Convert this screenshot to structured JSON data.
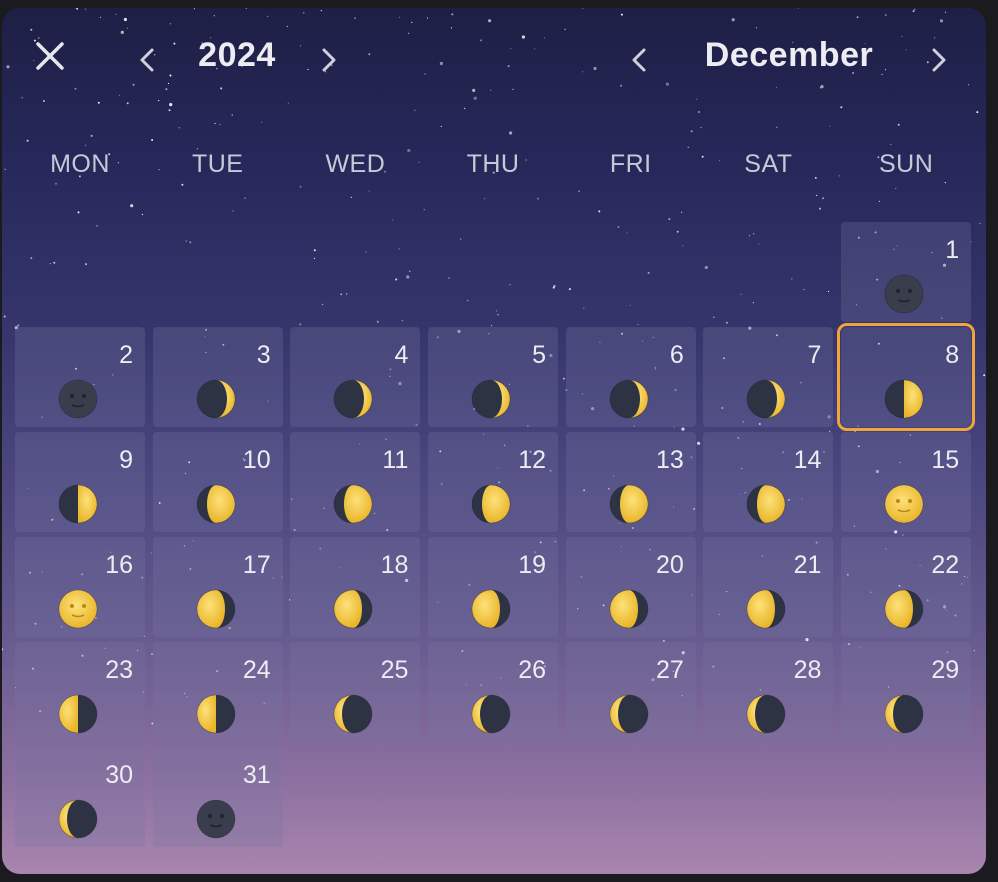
{
  "header": {
    "year": "2024",
    "month": "December",
    "close_icon": "close-icon",
    "prev_icon": "chevron-left-icon",
    "next_icon": "chevron-right-icon"
  },
  "weekdays": [
    "MON",
    "TUE",
    "WED",
    "THU",
    "FRI",
    "SAT",
    "SUN"
  ],
  "calendar": {
    "leading_blank_days": 6,
    "selected_day": 8,
    "days": [
      {
        "day": "1",
        "phase": "new-moon"
      },
      {
        "day": "2",
        "phase": "new-moon"
      },
      {
        "day": "3",
        "phase": "waxing-crescent"
      },
      {
        "day": "4",
        "phase": "waxing-crescent"
      },
      {
        "day": "5",
        "phase": "waxing-crescent"
      },
      {
        "day": "6",
        "phase": "waxing-crescent"
      },
      {
        "day": "7",
        "phase": "waxing-crescent"
      },
      {
        "day": "8",
        "phase": "first-quarter"
      },
      {
        "day": "9",
        "phase": "first-quarter"
      },
      {
        "day": "10",
        "phase": "waxing-gibbous"
      },
      {
        "day": "11",
        "phase": "waxing-gibbous"
      },
      {
        "day": "12",
        "phase": "waxing-gibbous"
      },
      {
        "day": "13",
        "phase": "waxing-gibbous"
      },
      {
        "day": "14",
        "phase": "waxing-gibbous"
      },
      {
        "day": "15",
        "phase": "full-moon"
      },
      {
        "day": "16",
        "phase": "full-moon"
      },
      {
        "day": "17",
        "phase": "waning-gibbous"
      },
      {
        "day": "18",
        "phase": "waning-gibbous"
      },
      {
        "day": "19",
        "phase": "waning-gibbous"
      },
      {
        "day": "20",
        "phase": "waning-gibbous"
      },
      {
        "day": "21",
        "phase": "waning-gibbous"
      },
      {
        "day": "22",
        "phase": "waning-gibbous"
      },
      {
        "day": "23",
        "phase": "last-quarter"
      },
      {
        "day": "24",
        "phase": "last-quarter"
      },
      {
        "day": "25",
        "phase": "waning-crescent"
      },
      {
        "day": "26",
        "phase": "waning-crescent"
      },
      {
        "day": "27",
        "phase": "waning-crescent"
      },
      {
        "day": "28",
        "phase": "waning-crescent"
      },
      {
        "day": "29",
        "phase": "waning-crescent"
      },
      {
        "day": "30",
        "phase": "waning-crescent"
      },
      {
        "day": "31",
        "phase": "new-moon"
      }
    ]
  },
  "colors": {
    "accent": "#f0a53a",
    "moon_lit": "#f4cf3a",
    "moon_dark": "#2e3344",
    "text": "#ececf2"
  }
}
